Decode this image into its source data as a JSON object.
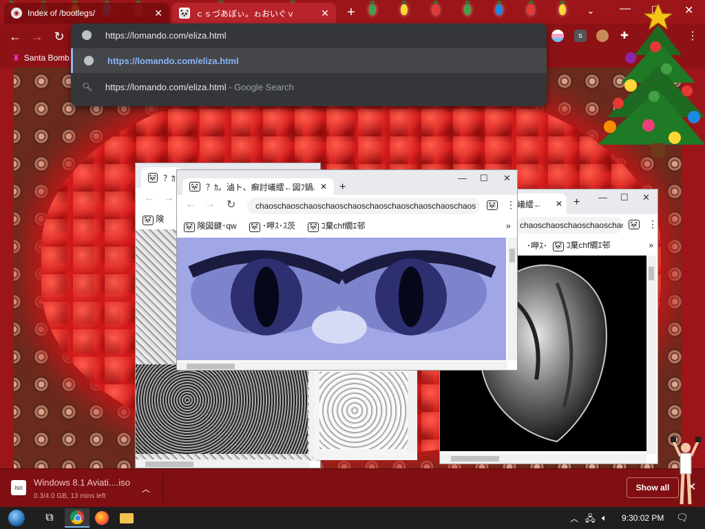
{
  "browser": {
    "tabs": [
      {
        "title": "Index of /bootlegs/",
        "close": "✕"
      },
      {
        "title": "ｃｓづあぼぃ。ゎおいぐｖ",
        "close": "✕"
      }
    ],
    "new_tab": "+",
    "tab_search": "⌄",
    "window_controls": {
      "minimize": "—",
      "maximize": "☐",
      "close": "✕"
    },
    "nav": {
      "back": "←",
      "forward": "→",
      "reload": "↻"
    },
    "omnibox": {
      "value": "https://lomando.com/eliza.html",
      "suggestions": [
        {
          "text": "https://lomando.com/eliza.html",
          "suffix": ""
        },
        {
          "text": "https://lomando.com/eliza.html",
          "suffix": " - Google Search"
        }
      ]
    },
    "bookmarks": [
      {
        "label": "Santa Bomb"
      }
    ],
    "menu": "⋮"
  },
  "popups": {
    "left": {
      "tab": "？ｶ",
      "bookmark": "険"
    },
    "middle": {
      "tab": "？ｶ。滷ト、癬討嶬繧←図ﾌ鍋△",
      "url": "chaoschaoschaoschaoschaoschaoschaoschaoschaoschaos",
      "bookmarks": [
        "険図鍵･qw",
        "･呷ｽ･ｽ茨",
        "ｺ棄chf繝ｴ邨"
      ],
      "controls": {
        "minimize": "—",
        "maximize": "☐",
        "close": "✕"
      }
    },
    "right": {
      "tab": "射嶬繧←",
      "url": "chaoschaoschaoschaoschao",
      "bookmarks": [
        "･呷ｽ･",
        "ｺ棄chf繝ｴ邨"
      ],
      "controls": {
        "minimize": "—",
        "maximize": "☐",
        "close": "✕"
      }
    }
  },
  "downloads": {
    "file_name": "Windows 8.1 Aviati....iso",
    "status": "0.3/4.0 GB, 13 mins left",
    "file_badge": "iso",
    "show_all": "Show all",
    "close": "✕"
  },
  "taskbar": {
    "clock": "9:30:02 PM"
  },
  "colors": {
    "browser_frame": "#9c1519",
    "omnibox_bg": "#35363a",
    "link": "#8ab4f8",
    "taskbar": "#1f1f1f"
  }
}
